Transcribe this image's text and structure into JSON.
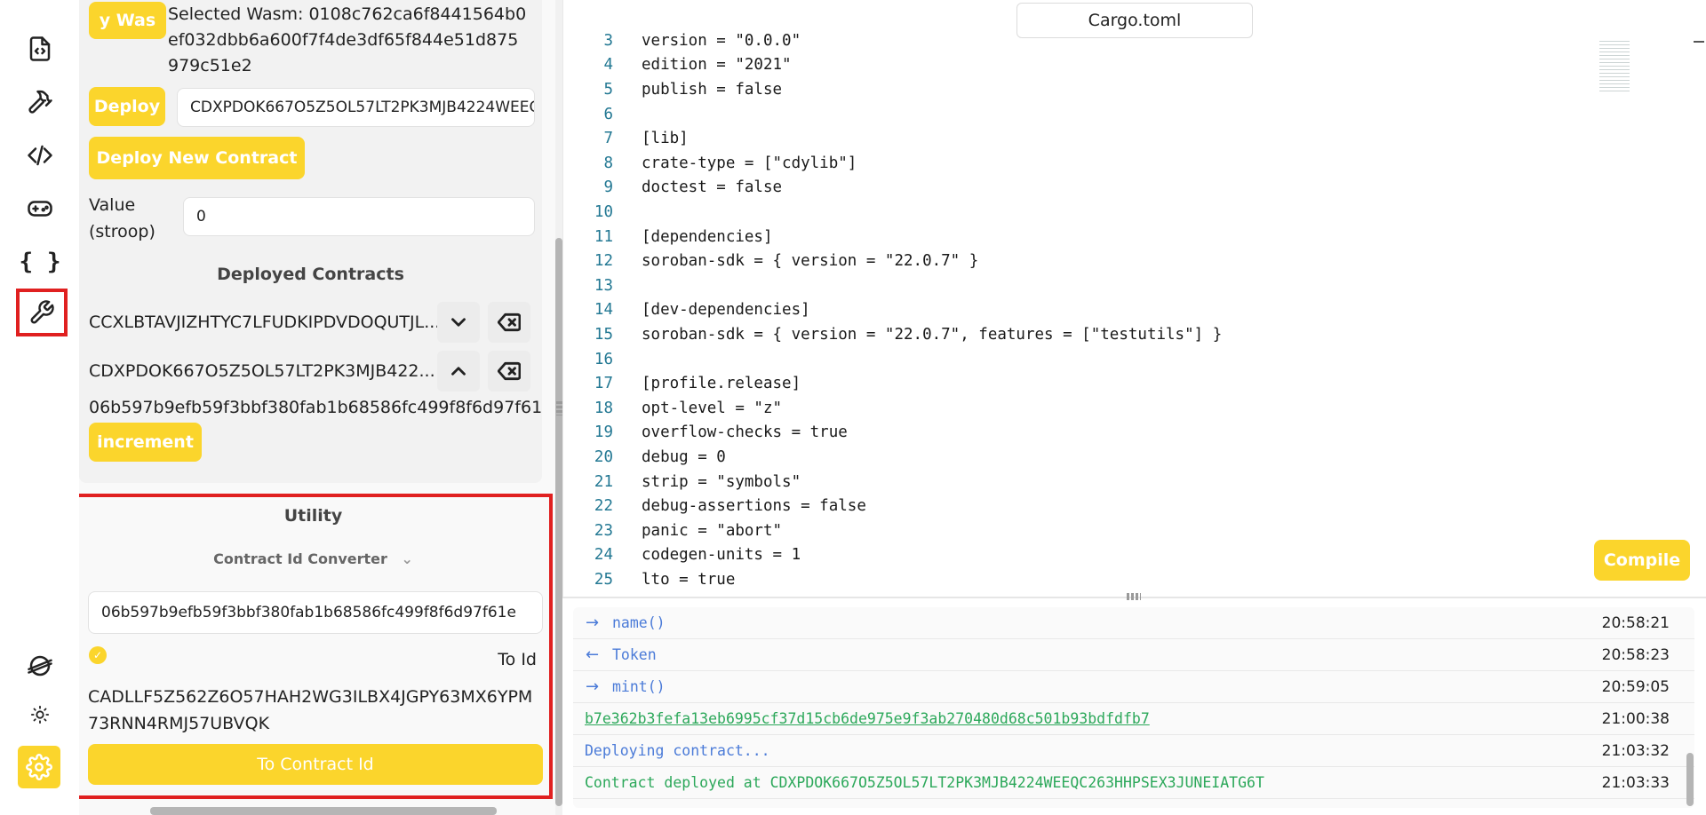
{
  "rail": {
    "items": [
      "file-code-icon",
      "hammer-icon",
      "code-icon",
      "gamepad-icon",
      "braces-icon",
      "wrench-icon"
    ],
    "braces_text": "{ }",
    "bottom": [
      "stellar-logo-icon",
      "sun-icon",
      "gear-icon"
    ]
  },
  "deploy": {
    "select_wasm_label": "y Was",
    "selected_wasm_text": "Selected Wasm: 0108c762ca6f8441564b0ef032dbb6a600f7f4de3df65f844e51d875979c51e2",
    "selected_wasm_lines": [
      "Selected Wasm: 0108c762ca6f8441564b0",
      "ef032dbb6a600f7f4de3df65f844e51d875",
      "979c51e2"
    ],
    "deploy_label": "Deploy",
    "deploy_input_value": "CDXPDOK667O5Z5OL57LT2PK3MJB4224WEEQ",
    "deploy_new_label": "Deploy New Contract",
    "value_label_1": "Value",
    "value_label_2": "(stroop)",
    "value_input": "0",
    "deployed_title": "Deployed Contracts",
    "contracts": [
      {
        "id": "CCXLBTAVJIZHTYC7LFUDKIPDVDOQUTJL...",
        "expanded": false
      },
      {
        "id": "CDXPDOK667O5Z5OL57LT2PK3MJB422...",
        "expanded": true
      }
    ],
    "contract_hash": "06b597b9efb59f3bbf380fab1b68586fc499f8f6d97f61",
    "increment_label": "increment"
  },
  "utility": {
    "title": "Utility",
    "dropdown_label": "Contract Id Converter",
    "input_value": "06b597b9efb59f3bbf380fab1b68586fc499f8f6d97f61e",
    "to_id_label": "To Id",
    "result_lines": [
      "CADLLF5Z562Z6O57HAH2WG3ILBX4JGPY63MX6YPM",
      "73RNN4RMJ57UBVQK"
    ],
    "to_contract_label": "To Contract Id"
  },
  "editor": {
    "tab": "Cargo.toml",
    "lines": [
      {
        "n": "3",
        "t": "version = \"0.0.0\""
      },
      {
        "n": "4",
        "t": "edition = \"2021\""
      },
      {
        "n": "5",
        "t": "publish = false"
      },
      {
        "n": "6",
        "t": ""
      },
      {
        "n": "7",
        "t": "[lib]"
      },
      {
        "n": "8",
        "t": "crate-type = [\"cdylib\"]"
      },
      {
        "n": "9",
        "t": "doctest = false"
      },
      {
        "n": "10",
        "t": ""
      },
      {
        "n": "11",
        "t": "[dependencies]"
      },
      {
        "n": "12",
        "t": "soroban-sdk = { version = \"22.0.7\" }"
      },
      {
        "n": "13",
        "t": ""
      },
      {
        "n": "14",
        "t": "[dev-dependencies]"
      },
      {
        "n": "15",
        "t": "soroban-sdk = { version = \"22.0.7\", features = [\"testutils\"] }"
      },
      {
        "n": "16",
        "t": ""
      },
      {
        "n": "17",
        "t": "[profile.release]"
      },
      {
        "n": "18",
        "t": "opt-level = \"z\""
      },
      {
        "n": "19",
        "t": "overflow-checks = true"
      },
      {
        "n": "20",
        "t": "debug = 0"
      },
      {
        "n": "21",
        "t": "strip = \"symbols\""
      },
      {
        "n": "22",
        "t": "debug-assertions = false"
      },
      {
        "n": "23",
        "t": "panic = \"abort\""
      },
      {
        "n": "24",
        "t": "codegen-units = 1"
      },
      {
        "n": "25",
        "t": "lto = true"
      }
    ],
    "compile_label": "Compile"
  },
  "terminal": {
    "rows": [
      {
        "arrow": "→",
        "msg": "name()",
        "style": "blue",
        "time": "20:58:21"
      },
      {
        "arrow": "←",
        "msg": "Token",
        "style": "blue",
        "time": "20:58:23"
      },
      {
        "arrow": "→",
        "msg": "mint()",
        "style": "blue",
        "time": "20:59:05"
      },
      {
        "arrow": "",
        "msg": "b7e362b3fefa13eb6995cf37d15cb6de975e9f3ab270480d68c501b93bdfdfb7",
        "style": "link",
        "time": "21:00:38"
      },
      {
        "arrow": "",
        "msg": "Deploying contract...",
        "style": "blue",
        "time": "21:03:32"
      },
      {
        "arrow": "",
        "msg": "Contract deployed at CDXPDOK667O5Z5OL57LT2PK3MJB4224WEEQC263HHPSEX3JUNEIATG6T",
        "style": "green",
        "time": "21:03:33"
      }
    ]
  },
  "colors": {
    "accent": "#fbd52c",
    "highlight": "#e02020",
    "log_blue": "#4b7bd8",
    "log_green": "#2ca85a"
  }
}
